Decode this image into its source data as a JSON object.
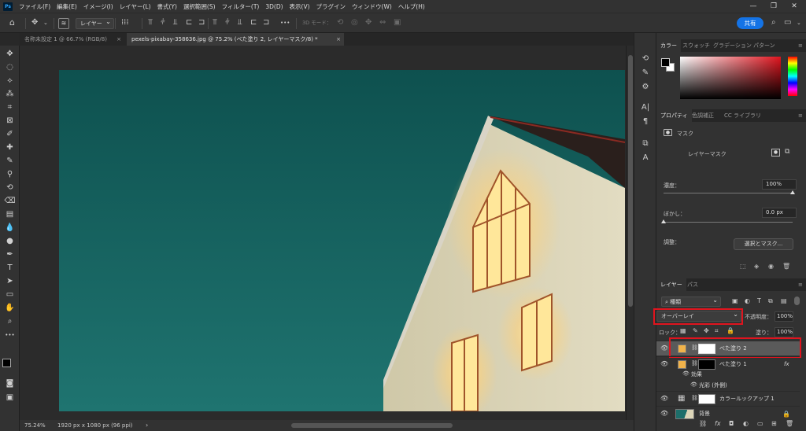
{
  "app": {
    "logo": "Ps",
    "menu": [
      "ファイル(F)",
      "編集(E)",
      "イメージ(I)",
      "レイヤー(L)",
      "書式(Y)",
      "選択範囲(S)",
      "フィルター(T)",
      "3D(D)",
      "表示(V)",
      "プラグイン",
      "ウィンドウ(W)",
      "ヘルプ(H)"
    ],
    "window_buttons": [
      "—",
      "❐",
      "✕"
    ]
  },
  "options_bar": {
    "layer_dropdown": "レイヤー",
    "mode_3d": "3D モード：",
    "share_label": "共有",
    "more": "•••"
  },
  "tabs": [
    {
      "label": "名称未設定 1 @ 66.7% (RGB/8)",
      "active": false
    },
    {
      "label": "pexels-pixabay-358636.jpg @ 75.2% (べた塗り 2, レイヤーマスク/8) *",
      "active": true
    }
  ],
  "status": {
    "zoom": "75.24%",
    "doc_info": "1920 px x 1080 px (96 ppi)"
  },
  "color_panel": {
    "tabs": [
      "カラー",
      "スウォッチ",
      "グラデーション",
      "パターン"
    ],
    "foreground": "#000000",
    "background": "#ffffff",
    "picker_hue": "#e0141e"
  },
  "properties": {
    "tabs": [
      "プロパティ",
      "色調補正",
      "CC ライブラリ"
    ],
    "section_label": "マスク",
    "mask_label": "レイヤーマスク",
    "density_label": "濃度：",
    "density_value": "100%",
    "density_level": 1.0,
    "feather_label": "ぼかし：",
    "feather_value": "0.0 px",
    "feather_level": 0.0,
    "adjust_label": "調整：",
    "select_mask_button": "選択とマスク..."
  },
  "layers_panel": {
    "tabs": [
      "レイヤー",
      "パス"
    ],
    "search_kind": "種類",
    "blend_mode": "オーバーレイ",
    "opacity_label": "不透明度：",
    "opacity_value": "100%",
    "lock_label": "ロック：",
    "fill_label": "塗り：",
    "fill_value": "100%",
    "layers": [
      {
        "name": "べた塗り 2",
        "selected": true,
        "thumb_color": "#f0b24a"
      },
      {
        "name": "べた塗り 1",
        "selected": false,
        "thumb_color": "#f0b24a",
        "fx": "fx"
      },
      {
        "name": "効果",
        "sub": true
      },
      {
        "name": "光彩 (外側)",
        "sub": true
      },
      {
        "name": "カラールックアップ 1",
        "selected": false
      },
      {
        "name": "背景",
        "selected": false
      }
    ],
    "footer_icons": [
      "link-icon",
      "fx-icon",
      "mask-icon",
      "adjustment-icon",
      "group-icon",
      "new-layer-icon",
      "trash-icon"
    ]
  },
  "colors": {
    "accent": "#1473e6",
    "highlight": "#e0141e",
    "sky": "#1d6e6a",
    "wall": "#dcd5b8",
    "window_glow": "#ffd76a"
  }
}
